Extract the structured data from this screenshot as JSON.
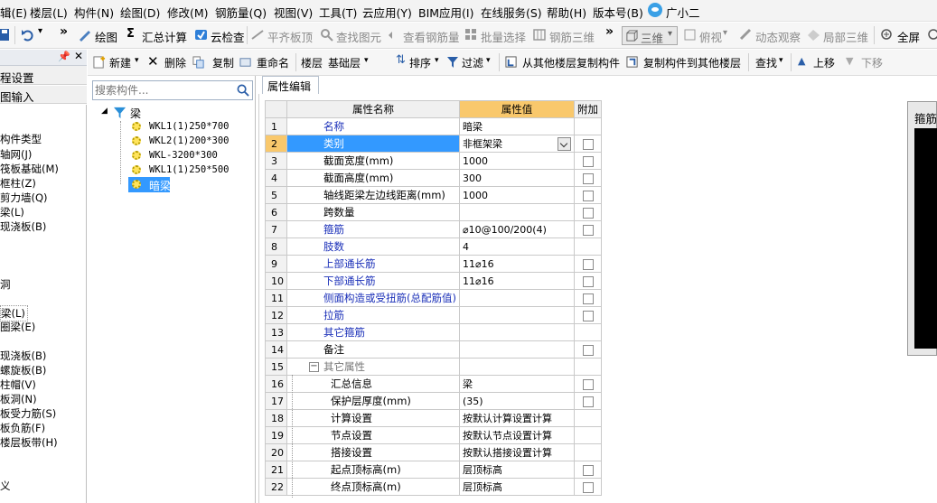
{
  "menubar": {
    "items": [
      "楼层(L)",
      "构件(N)",
      "绘图(D)",
      "修改(M)",
      "钢筋量(Q)",
      "视图(V)",
      "工具(T)",
      "云应用(Y)",
      "BIM应用(I)",
      "在线服务(S)",
      "帮助(H)",
      "版本号(B)"
    ],
    "first_item": "辑(E)",
    "assistant": "广小二"
  },
  "toolbar": {
    "draw": "绘图",
    "sum": "汇总计算",
    "cloud_check": "云检查",
    "flush_slab": "平齐板顶",
    "find_element": "查找图元",
    "view_rebar": "查看钢筋量",
    "batch_select": "批量选择",
    "rebar_3d": "钢筋三维",
    "view_mode": "三维",
    "top_view": "俯视",
    "dynamic_view": "动态观察",
    "partial_3d": "局部三维",
    "fullscreen": "全屏"
  },
  "left_panel": {
    "title1": "程设置",
    "title2": "图输入",
    "items": [
      "构件类型",
      "轴网(J)",
      "筏板基础(M)",
      "框柱(Z)",
      "剪力墙(Q)",
      "梁(L)",
      "现浇板(B)",
      "洞",
      "梁(L)",
      "圈梁(E)",
      "现浇板(B)",
      "螺旋板(B)",
      "柱帽(V)",
      "板洞(N)",
      "板受力筋(S)",
      "板负筋(F)",
      "楼层板带(H)",
      "义"
    ]
  },
  "toolbar2": {
    "new": "新建",
    "delete": "删除",
    "copy": "复制",
    "rename": "重命名",
    "floor_label": "楼层",
    "floor_value": "基础层",
    "sort": "排序",
    "filter": "过滤",
    "copy_from": "从其他楼层复制构件",
    "copy_to": "复制构件到其他楼层",
    "find": "查找",
    "move_up": "上移",
    "move_down": "下移"
  },
  "search": {
    "placeholder": "搜索构件..."
  },
  "tree": {
    "root": "梁",
    "children": [
      "WKL1(1)250*700",
      "WKL2(1)200*300",
      "WKL-3200*300",
      "WKL1(1)250*500",
      "暗梁"
    ]
  },
  "properties": {
    "tab": "属性编辑",
    "headers": {
      "name": "属性名称",
      "value": "属性值",
      "extra": "附加"
    },
    "rows": [
      {
        "n": "1",
        "name": "名称",
        "value": "暗梁",
        "style": "blue",
        "cb": false
      },
      {
        "n": "2",
        "name": "类别",
        "value": "非框架梁",
        "style": "blue",
        "cb": true
      },
      {
        "n": "3",
        "name": "截面宽度(mm)",
        "value": "1000",
        "style": "",
        "cb": true
      },
      {
        "n": "4",
        "name": "截面高度(mm)",
        "value": "300",
        "style": "",
        "cb": true
      },
      {
        "n": "5",
        "name": "轴线距梁左边线距离(mm)",
        "value": "1000",
        "style": "",
        "cb": true
      },
      {
        "n": "6",
        "name": "跨数量",
        "value": "",
        "style": "",
        "cb": true
      },
      {
        "n": "7",
        "name": "箍筋",
        "value": "⌀10@100/200(4)",
        "style": "blue",
        "cb": true
      },
      {
        "n": "8",
        "name": "肢数",
        "value": "4",
        "style": "blue",
        "cb": false
      },
      {
        "n": "9",
        "name": "上部通长筋",
        "value": "11⌀16",
        "style": "blue",
        "cb": true
      },
      {
        "n": "10",
        "name": "下部通长筋",
        "value": "11⌀16",
        "style": "blue",
        "cb": true
      },
      {
        "n": "11",
        "name": "侧面构造或受扭筋(总配筋值)",
        "value": "",
        "style": "blue",
        "cb": true
      },
      {
        "n": "12",
        "name": "拉筋",
        "value": "",
        "style": "blue",
        "cb": true
      },
      {
        "n": "13",
        "name": "其它箍筋",
        "value": "",
        "style": "blue",
        "cb": false
      },
      {
        "n": "14",
        "name": "备注",
        "value": "",
        "style": "",
        "cb": true
      },
      {
        "n": "15",
        "name": "其它属性",
        "value": "",
        "style": "gray",
        "cb": false
      },
      {
        "n": "16",
        "name": "汇总信息",
        "value": "梁",
        "style": "sub",
        "cb": true
      },
      {
        "n": "17",
        "name": "保护层厚度(mm)",
        "value": "(35)",
        "style": "sub",
        "cb": true
      },
      {
        "n": "18",
        "name": "计算设置",
        "value": "按默认计算设置计算",
        "style": "sub",
        "cb": false
      },
      {
        "n": "19",
        "name": "节点设置",
        "value": "按默认节点设置计算",
        "style": "sub",
        "cb": false
      },
      {
        "n": "20",
        "name": "搭接设置",
        "value": "按默认搭接设置计算",
        "style": "sub",
        "cb": false
      },
      {
        "n": "21",
        "name": "起点顶标高(m)",
        "value": "层顶标高",
        "style": "sub",
        "cb": true
      },
      {
        "n": "22",
        "name": "终点顶标高(m)",
        "value": "层顶标高",
        "style": "sub",
        "cb": true
      }
    ]
  },
  "preview": {
    "title": "箍筋"
  }
}
